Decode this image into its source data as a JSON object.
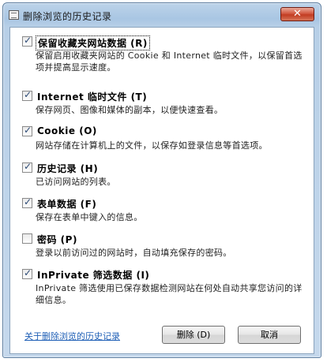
{
  "window": {
    "title": "删除浏览的历史记录",
    "close_label": "✕"
  },
  "options": [
    {
      "title": "保留收藏夹网站数据 (R)",
      "checked": true,
      "description": "保留启用收藏夹网站的 Cookie 和 Internet 临时文件，以保留首选项并提高显示速度。"
    },
    {
      "title": "Internet 临时文件 (T)",
      "checked": true,
      "description": "保存网页、图像和媒体的副本，以便快速查看。"
    },
    {
      "title": "Cookie (O)",
      "checked": true,
      "description": "网站存储在计算机上的文件，以保存如登录信息等首选项。"
    },
    {
      "title": "历史记录 (H)",
      "checked": true,
      "description": "已访问网站的列表。"
    },
    {
      "title": "表单数据 (F)",
      "checked": true,
      "description": "保存在表单中键入的信息。"
    },
    {
      "title": "密码 (P)",
      "checked": false,
      "description": "登录以前访问过的网站时，自动填充保存的密码。"
    },
    {
      "title": "InPrivate 筛选数据 (I)",
      "checked": true,
      "description": "InPrivate 筛选使用已保存数据检测网站在何处自动共享您访问的详细信息。"
    }
  ],
  "footer": {
    "help_link": "关于删除浏览的历史记录",
    "delete_button": "删除 (D)",
    "cancel_button": "取消"
  }
}
